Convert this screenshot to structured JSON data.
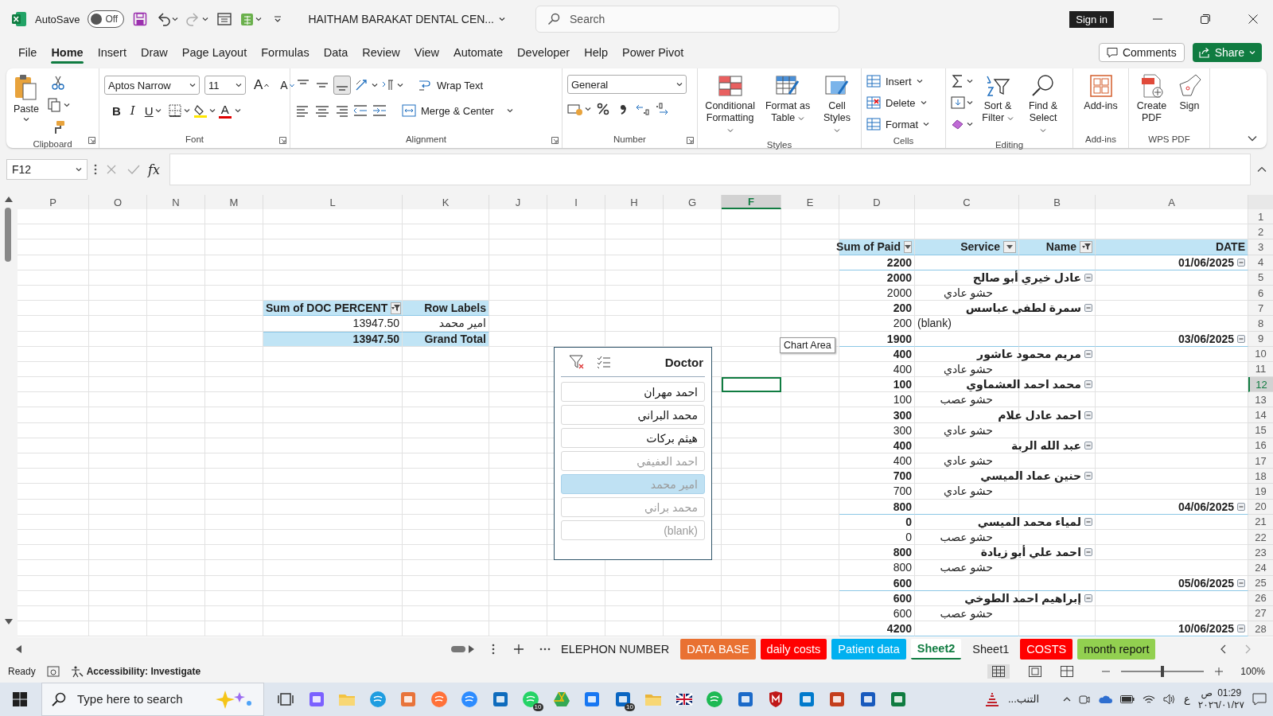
{
  "window": {
    "title": "HAITHAM BARAKAT DENTAL CEN...",
    "autosave_label": "AutoSave",
    "autosave": {
      "on": false,
      "label": "Off"
    },
    "search_placeholder": "Search",
    "sign_in": "Sign in"
  },
  "menu": [
    {
      "label": "File",
      "selected": false
    },
    {
      "label": "Home",
      "selected": true
    },
    {
      "label": "Insert",
      "selected": false
    },
    {
      "label": "Draw",
      "selected": false
    },
    {
      "label": "Page Layout",
      "selected": false
    },
    {
      "label": "Formulas",
      "selected": false
    },
    {
      "label": "Data",
      "selected": false
    },
    {
      "label": "Review",
      "selected": false
    },
    {
      "label": "View",
      "selected": false
    },
    {
      "label": "Automate",
      "selected": false
    },
    {
      "label": "Developer",
      "selected": false
    },
    {
      "label": "Help",
      "selected": false
    },
    {
      "label": "Power Pivot",
      "selected": false
    }
  ],
  "comments": "Comments",
  "share": "Share",
  "ribbon": {
    "clipboard": {
      "label": "Clipboard",
      "paste": "Paste"
    },
    "font": {
      "label": "Font",
      "family": "Aptos Narrow",
      "size": "11",
      "size_buttons": [
        "A",
        "A"
      ],
      "style_buttons": [
        "B",
        "I",
        "U"
      ],
      "color_button": "A"
    },
    "alignment": {
      "label": "Alignment",
      "wrap": "Wrap Text",
      "merge": "Merge & Center"
    },
    "number": {
      "label": "Number",
      "format": "General"
    },
    "styles": {
      "label": "Styles",
      "buttons": [
        "Conditional Formatting",
        "Format as Table",
        "Cell Styles"
      ]
    },
    "cells": {
      "label": "Cells",
      "buttons": [
        "Insert",
        "Delete",
        "Format"
      ]
    },
    "editing": {
      "label": "Editing",
      "buttons": [
        "Sort & Filter",
        "Find & Select"
      ]
    },
    "addins": {
      "label": "Add-ins",
      "buttons": [
        "Add-ins"
      ]
    },
    "wps": {
      "label": "WPS PDF",
      "buttons": [
        "Create PDF",
        "Sign"
      ]
    }
  },
  "formula_bar": {
    "name_box": "F12",
    "fx": "fx"
  },
  "sheet": {
    "columns": [
      {
        "label": "P",
        "selected": false
      },
      {
        "label": "O",
        "selected": false
      },
      {
        "label": "N",
        "selected": false
      },
      {
        "label": "M",
        "selected": false
      },
      {
        "label": "L",
        "selected": false
      },
      {
        "label": "K",
        "selected": false
      },
      {
        "label": "J",
        "selected": false
      },
      {
        "label": "I",
        "selected": false
      },
      {
        "label": "H",
        "selected": false
      },
      {
        "label": "G",
        "selected": false
      },
      {
        "label": "F",
        "selected": true
      },
      {
        "label": "E",
        "selected": false
      },
      {
        "label": "D",
        "selected": false
      },
      {
        "label": "C",
        "selected": false
      },
      {
        "label": "B",
        "selected": false
      },
      {
        "label": "A",
        "selected": false
      }
    ],
    "rows": [
      {
        "label": "1",
        "selected": false
      },
      {
        "label": "2",
        "selected": false
      },
      {
        "label": "3",
        "selected": false
      },
      {
        "label": "4",
        "selected": false
      },
      {
        "label": "5",
        "selected": false
      },
      {
        "label": "6",
        "selected": false
      },
      {
        "label": "7",
        "selected": false
      },
      {
        "label": "8",
        "selected": false
      },
      {
        "label": "9",
        "selected": false
      },
      {
        "label": "10",
        "selected": false
      },
      {
        "label": "11",
        "selected": false
      },
      {
        "label": "12",
        "selected": true
      },
      {
        "label": "13",
        "selected": false
      },
      {
        "label": "14",
        "selected": false
      },
      {
        "label": "15",
        "selected": false
      },
      {
        "label": "16",
        "selected": false
      },
      {
        "label": "17",
        "selected": false
      },
      {
        "label": "18",
        "selected": false
      },
      {
        "label": "19",
        "selected": false
      },
      {
        "label": "20",
        "selected": false
      },
      {
        "label": "21",
        "selected": false
      },
      {
        "label": "22",
        "selected": false
      },
      {
        "label": "23",
        "selected": false
      },
      {
        "label": "24",
        "selected": false
      },
      {
        "label": "25",
        "selected": false
      },
      {
        "label": "26",
        "selected": false
      },
      {
        "label": "27",
        "selected": false
      },
      {
        "label": "28",
        "selected": false
      }
    ],
    "pivot_paid": {
      "header": [
        {
          "label": "Sum of Paid",
          "dropdown": true,
          "filtered": false
        },
        {
          "label": "Service",
          "dropdown": true,
          "filtered": false
        },
        {
          "label": "Name",
          "dropdown": true,
          "filtered": true
        },
        {
          "label": "DATE",
          "dropdown": false
        }
      ],
      "rows": [
        {
          "kind": "date",
          "label": "01/06/2025",
          "paid": "2200"
        },
        {
          "kind": "name",
          "label": "عادل خيري أبو صالح",
          "paid": "2000"
        },
        {
          "kind": "service",
          "label": "حشو عادي",
          "paid": "2000"
        },
        {
          "kind": "name",
          "label": "سمرة لطفي عباسس",
          "paid": "200"
        },
        {
          "kind": "service",
          "label": "(blank)",
          "paid": "200"
        },
        {
          "kind": "date",
          "label": "03/06/2025",
          "paid": "1900"
        },
        {
          "kind": "name",
          "label": "مريم محمود عاشور",
          "paid": "400"
        },
        {
          "kind": "service",
          "label": "حشو عادي",
          "paid": "400"
        },
        {
          "kind": "name",
          "label": "محمد احمد العشماوي",
          "paid": "100"
        },
        {
          "kind": "service",
          "label": "حشو عصب",
          "paid": "100"
        },
        {
          "kind": "name",
          "label": "احمد عادل علام",
          "paid": "300"
        },
        {
          "kind": "service",
          "label": "حشو عادي",
          "paid": "300"
        },
        {
          "kind": "name",
          "label": "عبد الله الربة",
          "paid": "400"
        },
        {
          "kind": "service",
          "label": "حشو عادي",
          "paid": "400"
        },
        {
          "kind": "name",
          "label": "حنين عماد الميسي",
          "paid": "700"
        },
        {
          "kind": "service",
          "label": "حشو عادي",
          "paid": "700"
        },
        {
          "kind": "date",
          "label": "04/06/2025",
          "paid": "800"
        },
        {
          "kind": "name",
          "label": "لمياء محمد الميسي",
          "paid": "0"
        },
        {
          "kind": "service",
          "label": "حشو عصب",
          "paid": "0"
        },
        {
          "kind": "name",
          "label": "احمد علي أبو زيادة",
          "paid": "800"
        },
        {
          "kind": "service",
          "label": "حشو عصب",
          "paid": "800"
        },
        {
          "kind": "date",
          "label": "05/06/2025",
          "paid": "600"
        },
        {
          "kind": "name",
          "label": "إبراهيم احمد الطوخي",
          "paid": "600"
        },
        {
          "kind": "service",
          "label": "حشو عصب",
          "paid": "600"
        },
        {
          "kind": "date",
          "label": "10/06/2025",
          "paid": "4200"
        }
      ]
    },
    "pivot_doc": {
      "header": [
        {
          "label": "Sum of DOC PERCENT",
          "dropdown": true,
          "filtered": true
        },
        {
          "label": "Row Labels",
          "dropdown": false
        }
      ],
      "rows": [
        {
          "kind": "item",
          "value": "13947.50",
          "label": "امير محمد"
        },
        {
          "kind": "total",
          "value": "13947.50",
          "label": "Grand Total"
        }
      ]
    },
    "slicer": {
      "title": "Doctor",
      "items": [
        {
          "label": "احمد مهران",
          "selected": false,
          "disabled": false
        },
        {
          "label": "محمد البراني",
          "selected": false,
          "disabled": false
        },
        {
          "label": "هيثم بركات",
          "selected": false,
          "disabled": false
        },
        {
          "label": "احمد العفيفي",
          "selected": false,
          "disabled": true
        },
        {
          "label": "امير محمد",
          "selected": true,
          "disabled": true
        },
        {
          "label": "محمد براني",
          "selected": false,
          "disabled": true
        },
        {
          "label": "(blank)",
          "selected": false,
          "disabled": true
        }
      ]
    },
    "tooltip": "Chart Area"
  },
  "sheet_tabs": [
    {
      "label": "ELEPHON NUMBER",
      "selected": false
    },
    {
      "label": "DATA BASE",
      "selected": false,
      "color": "#e97132"
    },
    {
      "label": "daily costs",
      "selected": false,
      "color": "#ff0000"
    },
    {
      "label": "Patient data",
      "selected": false,
      "color": "#00b0f0"
    },
    {
      "label": "Sheet2",
      "selected": true
    },
    {
      "label": "Sheet1",
      "selected": false
    },
    {
      "label": "COSTS",
      "selected": false,
      "color": "#ff0000"
    },
    {
      "label": "month report",
      "selected": false,
      "color": "#92d050"
    }
  ],
  "status_bar": {
    "ready": "Ready",
    "accessibility": "Accessibility: Investigate",
    "zoom": {
      "level": 0.5,
      "label": "100%"
    }
  },
  "taskbar": {
    "search_placeholder": "Type here to search",
    "apps": [
      {
        "kind": "taskview"
      },
      {
        "kind": "copilot"
      },
      {
        "kind": "folder"
      },
      {
        "kind": "edge"
      },
      {
        "kind": "store"
      },
      {
        "kind": "firefox"
      },
      {
        "kind": "zoom"
      },
      {
        "kind": "outlook"
      },
      {
        "kind": "whatsapp",
        "badge": "10"
      },
      {
        "kind": "drive"
      },
      {
        "kind": "facebook"
      },
      {
        "kind": "linkedin",
        "badge": "10"
      },
      {
        "kind": "files"
      },
      {
        "kind": "flag"
      },
      {
        "kind": "spotify"
      },
      {
        "kind": "blueapp"
      },
      {
        "kind": "shield"
      },
      {
        "kind": "code"
      },
      {
        "kind": "slides"
      },
      {
        "kind": "word"
      },
      {
        "kind": "excel"
      }
    ],
    "weather": "التنب...",
    "language": "ع",
    "time": "01:29",
    "period": "ص",
    "date": "٢٠٢٦/٠١/٢٧"
  }
}
